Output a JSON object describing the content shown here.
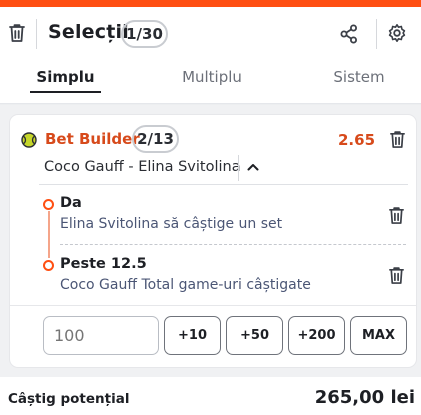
{
  "header": {
    "title": "Selecții",
    "count": "1/30",
    "tabs": [
      {
        "label": "Simplu",
        "active": true
      },
      {
        "label": "Multiplu",
        "active": false
      },
      {
        "label": "Sistem",
        "active": false
      }
    ],
    "icons": [
      "trash-icon",
      "share-icon",
      "gear-icon"
    ]
  },
  "bet_builder": {
    "icon": "tennis-ball-icon",
    "title": "Bet Builder",
    "count": "2/13",
    "odds": "2.65",
    "match": "Coco Gauff - Elina Svitolina",
    "selections": [
      {
        "name": "Da",
        "description": "Elina Svitolina să câștige un set"
      },
      {
        "name": "Peste 12.5",
        "description": "Coco Gauff Total game-uri câștigate"
      }
    ]
  },
  "stake": {
    "placeholder": "100",
    "quick_buttons": [
      "+10",
      "+50",
      "+200",
      "MAX"
    ]
  },
  "footer": {
    "label": "Câștig potențial",
    "value": "265,00 lei"
  },
  "colors": {
    "accent": "#ff4f12",
    "odds": "#d74a1b",
    "text": "#1d1f24",
    "description": "#4b5675"
  }
}
